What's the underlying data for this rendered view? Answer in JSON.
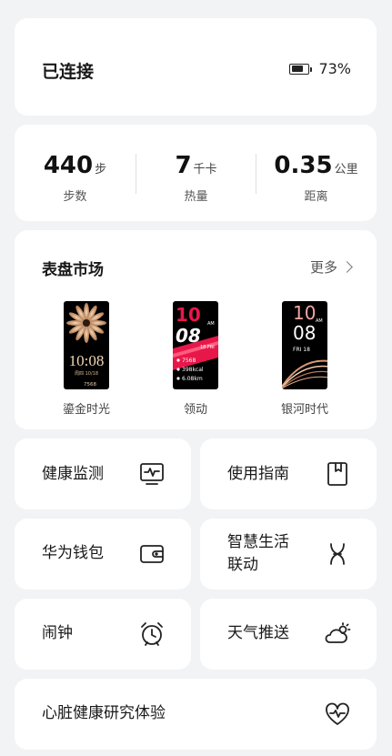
{
  "connection": {
    "status": "已连接",
    "battery_percent": 73,
    "battery_text": "73%"
  },
  "stats": [
    {
      "value": "440",
      "unit": "步",
      "label": "步数"
    },
    {
      "value": "7",
      "unit": "千卡",
      "label": "热量"
    },
    {
      "value": "0.35",
      "unit": "公里",
      "label": "距离"
    }
  ],
  "market": {
    "title": "表盘市场",
    "more_label": "更多",
    "faces": [
      {
        "name": "鎏金时光",
        "time": "10:08",
        "date": "周四 10/18",
        "steps": "7568"
      },
      {
        "name": "领动",
        "time_top": "10",
        "time_bottom": "08",
        "ampm": "AM",
        "date": "18 FRI",
        "steps": "7568",
        "calories": "398kcal",
        "distance": "6.08km"
      },
      {
        "name": "银河时代",
        "time_top": "10",
        "time_bottom": "08",
        "ampm": "AM",
        "date": "FRI 18"
      }
    ]
  },
  "features": [
    {
      "label": "健康监测",
      "icon": "health-monitor-icon"
    },
    {
      "label": "使用指南",
      "icon": "guide-book-icon"
    },
    {
      "label": "华为钱包",
      "icon": "wallet-icon"
    },
    {
      "label_line1": "智慧生活",
      "label_line2": "联动",
      "icon": "smart-link-icon"
    },
    {
      "label": "闹钟",
      "icon": "alarm-clock-icon"
    },
    {
      "label": "天气推送",
      "icon": "weather-icon"
    },
    {
      "label": "心脏健康研究体验",
      "icon": "heart-rate-icon"
    }
  ],
  "colors": {
    "background": "#f1f3f5",
    "card": "#ffffff",
    "accent_red": "#e8174a"
  }
}
